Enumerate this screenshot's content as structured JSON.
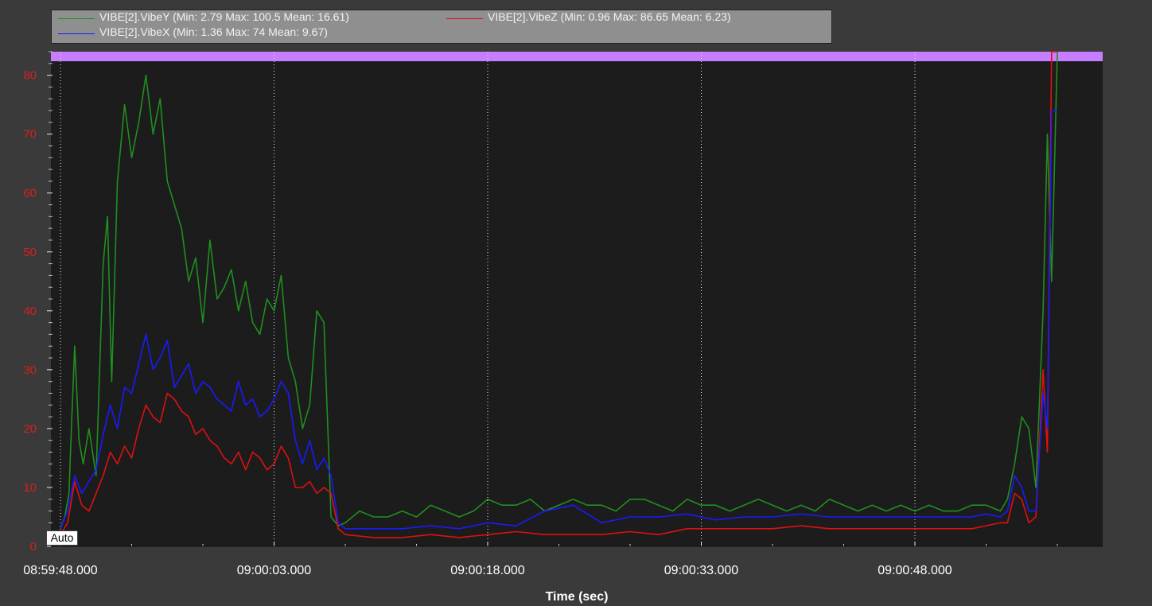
{
  "chart_data": {
    "type": "line",
    "title": "",
    "xlabel": "Time (sec)",
    "ylabel": "",
    "x_range": [
      0,
      70
    ],
    "ylim": [
      0,
      84
    ],
    "x_ticks": [
      {
        "t": 0,
        "label": "08:59:48.000"
      },
      {
        "t": 15,
        "label": "09:00:03.000"
      },
      {
        "t": 30,
        "label": "09:00:18.000"
      },
      {
        "t": 45,
        "label": "09:00:33.000"
      },
      {
        "t": 60,
        "label": "09:00:48.000"
      }
    ],
    "y_ticks": [
      0,
      10,
      20,
      30,
      40,
      50,
      60,
      70,
      80
    ],
    "grid": "vertical dotted",
    "legend_position": "top-left",
    "top_band_color": "#c77dff",
    "series": [
      {
        "name": "VIBE[2].VibeY",
        "legend_text": "VIBE[2].VibeY  (Min: 2.79 Max: 100.5 Mean: 16.61)",
        "color": "#1f8f1f",
        "x": [
          0,
          0.3,
          0.6,
          0.8,
          1.0,
          1.3,
          1.6,
          2.0,
          2.5,
          3.0,
          3.3,
          3.6,
          4.0,
          4.5,
          5.0,
          5.5,
          6.0,
          6.5,
          7.0,
          7.5,
          8.0,
          8.5,
          9.0,
          9.5,
          10.0,
          10.5,
          11.0,
          11.5,
          12.0,
          12.5,
          13.0,
          13.5,
          14.0,
          14.5,
          15.0,
          15.5,
          16.0,
          16.5,
          17.0,
          17.5,
          18.0,
          18.5,
          19.0,
          19.5,
          20.0,
          21,
          22,
          23,
          24,
          25,
          26,
          27,
          28,
          29,
          30,
          31,
          32,
          33,
          34,
          35,
          36,
          37,
          38,
          39,
          40,
          41,
          42,
          43,
          44,
          45,
          46,
          47,
          48,
          49,
          50,
          51,
          52,
          53,
          54,
          55,
          56,
          57,
          58,
          59,
          60,
          61,
          62,
          63,
          64,
          65,
          66,
          66.5,
          67,
          67.5,
          68,
          68.5,
          69,
          69.3,
          69.6,
          70
        ],
        "y": [
          3,
          5,
          9,
          22,
          34,
          18,
          14,
          20,
          12,
          48,
          56,
          28,
          62,
          75,
          66,
          72,
          80,
          70,
          76,
          62,
          58,
          54,
          45,
          49,
          38,
          52,
          42,
          44,
          47,
          40,
          45,
          38,
          36,
          42,
          40,
          46,
          32,
          28,
          20,
          24,
          40,
          38,
          5,
          3.5,
          4,
          6,
          5,
          5,
          6,
          5,
          7,
          6,
          5,
          6,
          8,
          7,
          7,
          8,
          6,
          7,
          8,
          7,
          7,
          6,
          8,
          8,
          7,
          6,
          8,
          7,
          7,
          6,
          7,
          8,
          7,
          6,
          7,
          6,
          8,
          7,
          6,
          7,
          6,
          7,
          6,
          7,
          6,
          6,
          7,
          7,
          6,
          8,
          14,
          22,
          20,
          10,
          40,
          70,
          45,
          84
        ]
      },
      {
        "name": "VIBE[2].VibeZ",
        "legend_text": "VIBE[2].VibeZ  (Min: 0.96 Max: 86.65 Mean: 6.23)",
        "color": "#e01010",
        "x": [
          0,
          0.5,
          1.0,
          1.5,
          2.0,
          2.5,
          3.0,
          3.5,
          4.0,
          4.5,
          5.0,
          5.5,
          6.0,
          6.5,
          7.0,
          7.5,
          8.0,
          8.5,
          9.0,
          9.5,
          10.0,
          10.5,
          11.0,
          11.5,
          12.0,
          12.5,
          13.0,
          13.5,
          14.0,
          14.5,
          15.0,
          15.5,
          16.0,
          16.5,
          17.0,
          17.5,
          18.0,
          18.5,
          19.0,
          19.5,
          20.0,
          22,
          24,
          26,
          28,
          30,
          32,
          34,
          36,
          38,
          40,
          42,
          44,
          46,
          48,
          50,
          52,
          54,
          56,
          58,
          60,
          62,
          64,
          65,
          66,
          66.5,
          67,
          67.5,
          68,
          68.5,
          69,
          69.3,
          69.6,
          70
        ],
        "y": [
          2,
          4,
          11,
          7,
          6,
          9,
          12,
          16,
          14,
          17,
          15,
          20,
          24,
          22,
          21,
          26,
          25,
          23,
          22,
          19,
          20,
          18,
          17,
          15,
          14,
          16,
          13,
          16,
          15,
          13,
          14,
          17,
          15,
          10,
          10,
          11,
          9,
          10,
          9,
          3,
          2,
          1.5,
          1.5,
          2,
          1.5,
          2,
          2.5,
          2,
          2,
          2,
          2.5,
          2,
          3,
          3,
          3,
          3,
          3.5,
          3,
          3,
          3,
          3,
          3,
          3,
          3.5,
          4,
          4,
          9,
          8,
          4,
          5,
          30,
          16,
          86,
          86
        ]
      },
      {
        "name": "VIBE[2].VibeX",
        "legend_text": "VIBE[2].VibeX  (Min: 1.36 Max: 74 Mean: 9.67)",
        "color": "#1a1aff",
        "x": [
          0,
          0.5,
          1.0,
          1.5,
          2.0,
          2.5,
          3.0,
          3.5,
          4.0,
          4.5,
          5.0,
          5.5,
          6.0,
          6.5,
          7.0,
          7.5,
          8.0,
          8.5,
          9.0,
          9.5,
          10.0,
          10.5,
          11.0,
          11.5,
          12.0,
          12.5,
          13.0,
          13.5,
          14.0,
          14.5,
          15.0,
          15.5,
          16.0,
          16.5,
          17.0,
          17.5,
          18.0,
          18.5,
          19.0,
          19.5,
          20.0,
          22,
          24,
          26,
          28,
          30,
          32,
          34,
          36,
          38,
          40,
          42,
          44,
          46,
          48,
          50,
          52,
          54,
          56,
          58,
          60,
          62,
          64,
          65,
          66,
          66.5,
          67,
          67.5,
          68,
          68.5,
          69,
          69.3,
          69.6,
          70
        ],
        "y": [
          3,
          6,
          12,
          9,
          11,
          13,
          19,
          24,
          20,
          27,
          26,
          31,
          36,
          30,
          32,
          35,
          27,
          29,
          31,
          26,
          28,
          27,
          25,
          24,
          23,
          28,
          24,
          25,
          22,
          23,
          25,
          28,
          26,
          18,
          14,
          18,
          13,
          15,
          12,
          4,
          3,
          3,
          3,
          3.5,
          3,
          4,
          3.5,
          6,
          7,
          4,
          5,
          5,
          5.5,
          4.5,
          5,
          5,
          5.5,
          5,
          5,
          5,
          5,
          5,
          5,
          5.5,
          5,
          6,
          12,
          10,
          6,
          6,
          26,
          20,
          74,
          74
        ]
      }
    ]
  },
  "legend": {
    "vibey": "VIBE[2].VibeY  (Min: 2.79 Max: 100.5 Mean: 16.61)",
    "vibez": "VIBE[2].VibeZ  (Min: 0.96 Max: 86.65 Mean: 6.23)",
    "vibex": "VIBE[2].VibeX  (Min: 1.36 Max: 74 Mean: 9.67)"
  },
  "auto_button_label": "Auto"
}
